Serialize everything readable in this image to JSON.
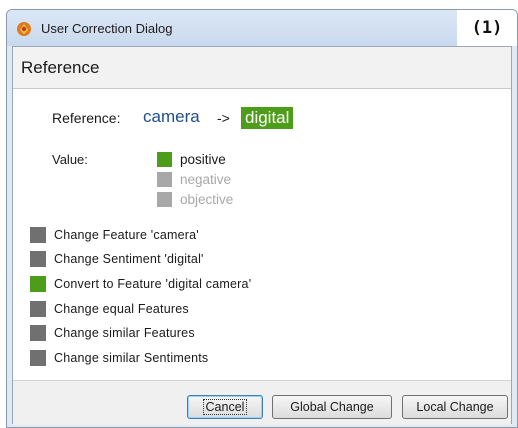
{
  "window": {
    "title": "User Correction Dialog",
    "panel_number": "(1)",
    "app_icon": "app-icon"
  },
  "section": {
    "title": "Reference"
  },
  "reference": {
    "label": "Reference:",
    "source": "camera",
    "arrow": "->",
    "target": "digital"
  },
  "value": {
    "label": "Value:",
    "options": [
      {
        "label": "positive",
        "state": "selected"
      },
      {
        "label": "negative",
        "state": "disabled"
      },
      {
        "label": "objective",
        "state": "disabled"
      }
    ]
  },
  "actions": [
    {
      "label": "Change Feature 'camera'",
      "state": "unselected"
    },
    {
      "label": "Change Sentiment 'digital'",
      "state": "unselected"
    },
    {
      "label": "Convert to Feature 'digital camera'",
      "state": "selected"
    },
    {
      "label": "Change equal Features",
      "state": "unselected"
    },
    {
      "label": "Change similar Features",
      "state": "unselected"
    },
    {
      "label": "Change similar Sentiments",
      "state": "unselected"
    }
  ],
  "buttons": {
    "cancel": "Cancel",
    "global_change": "Global Change",
    "local_change": "Local Change"
  },
  "colors": {
    "selected": "#4e9d1a",
    "unselected": "#707070",
    "disabled": "#a8a8a8",
    "reference_source": "#1f4e8c"
  }
}
